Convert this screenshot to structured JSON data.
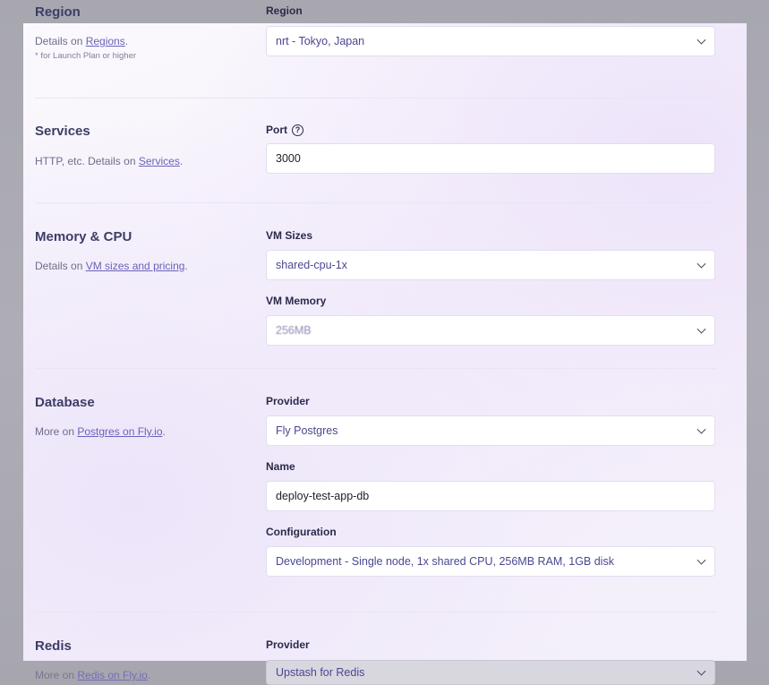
{
  "region": {
    "title": "Region",
    "desc_prefix": "Details on ",
    "desc_link": "Regions",
    "desc_suffix": ".",
    "note": "* for Launch Plan or higher",
    "field_label": "Region",
    "value": "nrt - Tokyo, Japan"
  },
  "services": {
    "title": "Services",
    "desc_prefix": "HTTP, etc. Details on ",
    "desc_link": "Services",
    "desc_suffix": ".",
    "port_label": "Port",
    "help_glyph": "?",
    "port_value": "3000"
  },
  "memory_cpu": {
    "title": "Memory & CPU",
    "desc_prefix": "Details on ",
    "desc_link": "VM sizes and pricing",
    "desc_suffix": ".",
    "vm_sizes_label": "VM Sizes",
    "vm_sizes_value": "shared-cpu-1x",
    "vm_memory_label": "VM Memory",
    "vm_memory_value": "256MB"
  },
  "database": {
    "title": "Database",
    "desc_prefix": "More on ",
    "desc_link": "Postgres on Fly.io",
    "desc_suffix": ".",
    "provider_label": "Provider",
    "provider_value": "Fly Postgres",
    "name_label": "Name",
    "name_value": "deploy-test-app-db",
    "config_label": "Configuration",
    "config_value": "Development - Single node, 1x shared CPU, 256MB RAM, 1GB disk"
  },
  "redis": {
    "title": "Redis",
    "desc_prefix": "More on ",
    "desc_link": "Redis on Fly.io",
    "desc_suffix": ".",
    "provider_label": "Provider",
    "provider_value": "Upstash for Redis"
  }
}
